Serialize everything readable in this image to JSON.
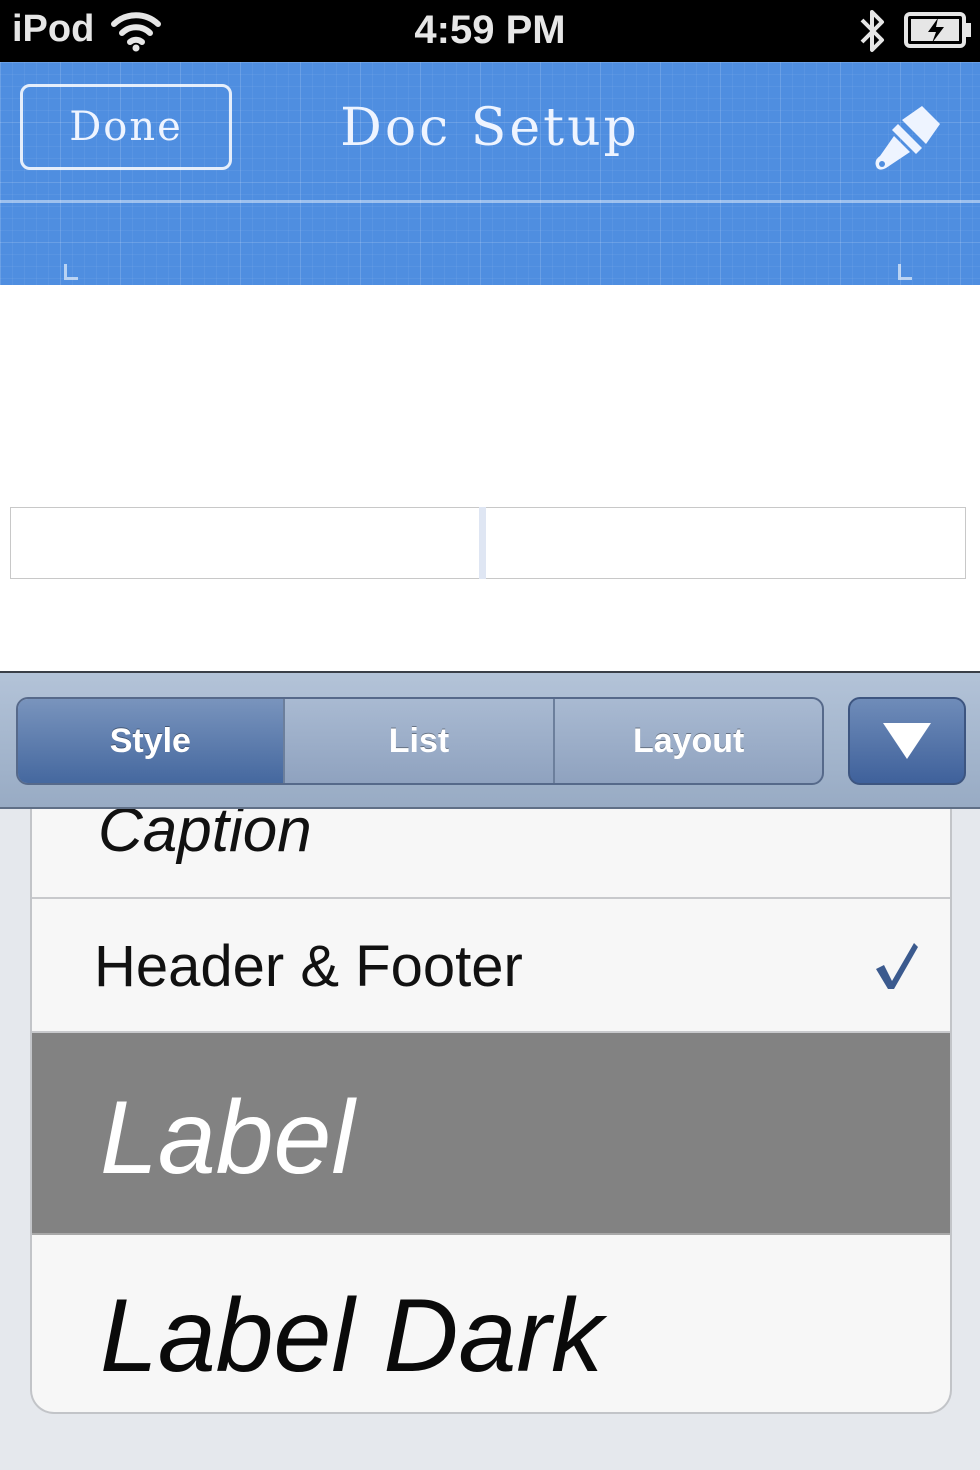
{
  "status_bar": {
    "carrier": "iPod",
    "time": "4:59 PM"
  },
  "navbar": {
    "done_label": "Done",
    "title": "Doc Setup"
  },
  "toolbar": {
    "tabs": [
      {
        "label": "Style",
        "active": true
      },
      {
        "label": "List",
        "active": false
      },
      {
        "label": "Layout",
        "active": false
      }
    ]
  },
  "styles_list": {
    "items": [
      {
        "label": "Caption"
      },
      {
        "label": "Header & Footer",
        "checked": true
      },
      {
        "label": "Label",
        "highlighted": true
      },
      {
        "label": "Label Dark"
      }
    ]
  },
  "colors": {
    "blueprint": "#4f8ee0",
    "active_segment": "#45689f",
    "checkmark": "#3b5a8e",
    "highlight_row": "#828282"
  },
  "icons": {
    "wifi": "wifi-icon",
    "bluetooth": "bluetooth-icon",
    "battery": "battery-charging-icon",
    "brush": "paintbrush-icon",
    "collapse": "triangle-down-icon",
    "check": "checkmark-icon"
  }
}
